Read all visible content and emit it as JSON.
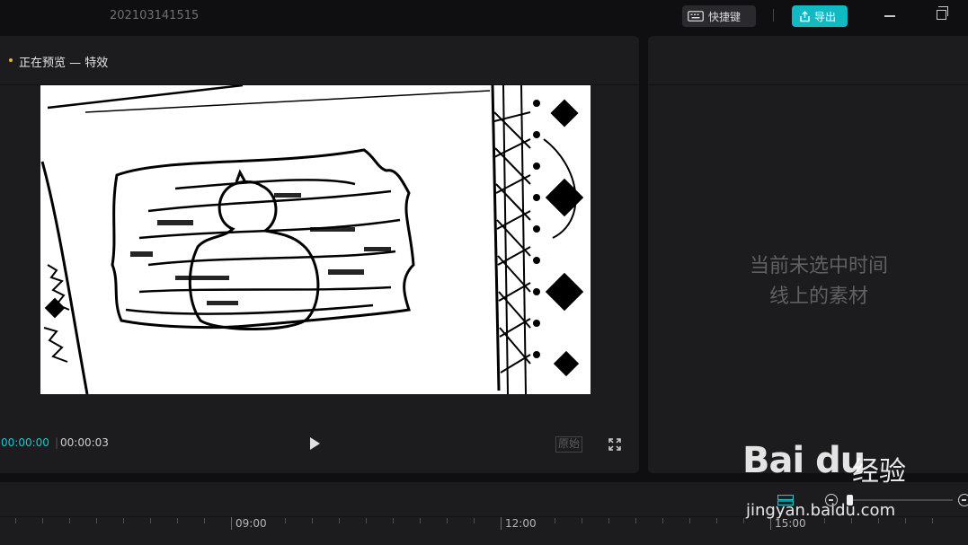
{
  "titlebar": {
    "project_name": "202103141515",
    "shortcut_label": "快捷键",
    "export_label": "导出"
  },
  "preview": {
    "title": "正在预览 — 特效",
    "time_current": "00:00:00",
    "time_separator": "|",
    "time_total": "00:00:03",
    "ratio_label": "原始"
  },
  "properties": {
    "empty_line1": "当前未选中时间",
    "empty_line2": "线上的素材"
  },
  "timeline": {
    "ruler_labels": [
      "09:00",
      "12:00",
      "15:00"
    ]
  },
  "watermark": {
    "logo": "Bai du",
    "cn": "经验",
    "url": "jingyan.baidu.com"
  },
  "colors": {
    "accent": "#11b9c3",
    "time_current": "#1cc6d0",
    "dot": "#f3b31a"
  },
  "icons": [
    "keyboard-icon",
    "export-icon",
    "minimize-icon",
    "maximize-icon",
    "play-icon",
    "fullscreen-icon",
    "zoom-in-icon",
    "zoom-out-icon",
    "snap-icon"
  ]
}
